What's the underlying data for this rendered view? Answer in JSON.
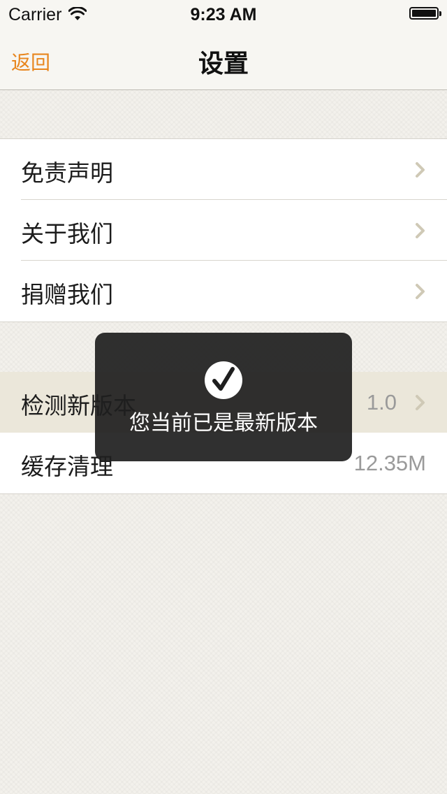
{
  "status_bar": {
    "carrier": "Carrier",
    "time": "9:23 AM",
    "icons": [
      "wifi-icon",
      "battery-icon"
    ]
  },
  "nav": {
    "back_label": "返回",
    "title": "设置"
  },
  "groups": [
    {
      "rows": [
        {
          "label": "免责声明",
          "icon": "chevron-right-icon"
        },
        {
          "label": "关于我们",
          "icon": "chevron-right-icon"
        },
        {
          "label": "捐赠我们",
          "icon": "chevron-right-icon"
        }
      ]
    },
    {
      "rows": [
        {
          "label": "检测新版本",
          "value": "1.0",
          "icon": "chevron-right-icon",
          "highlighted": true
        },
        {
          "label": "缓存清理",
          "value": "12.35M"
        }
      ]
    }
  ],
  "toast": {
    "icon": "checkmark-icon",
    "message": "您当前已是最新版本"
  },
  "colors": {
    "accent": "#e8861e",
    "background": "#f3f1ec",
    "highlight_row": "#ebe7da",
    "chevron": "#cfc9b6",
    "toast_bg": "#1e1e1e"
  }
}
